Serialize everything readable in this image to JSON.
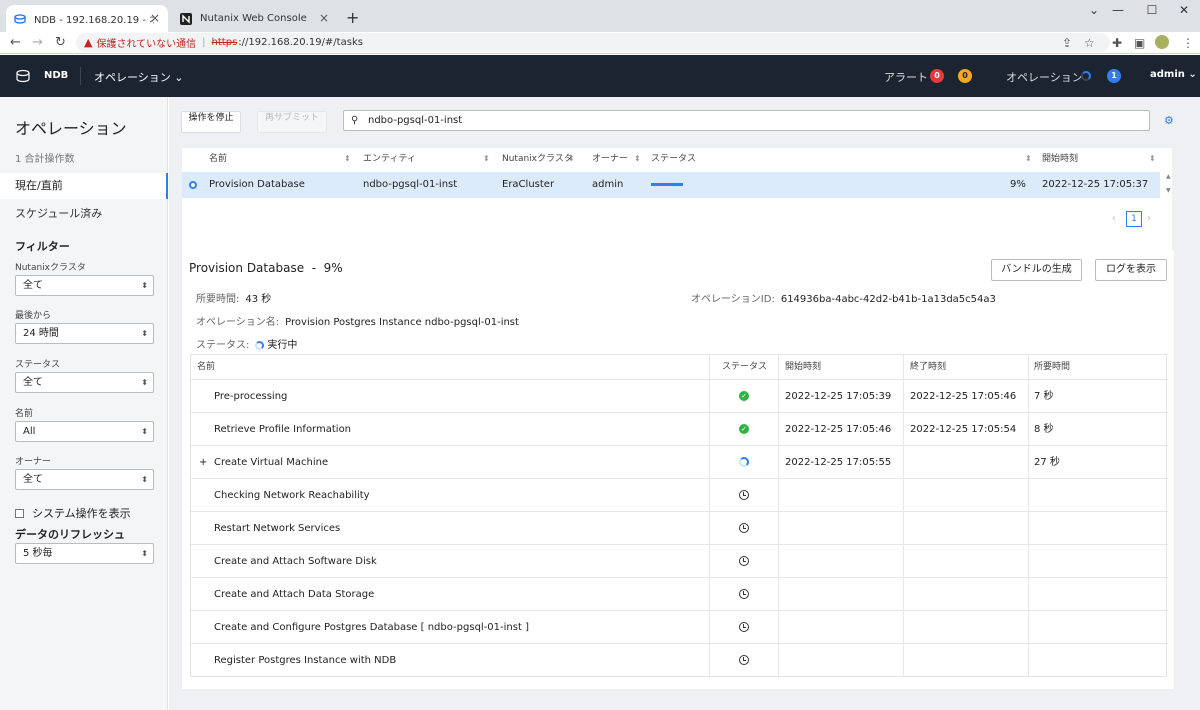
{
  "browser": {
    "tabs": [
      {
        "title": "NDB - 192.168.20.19 - オペレーショ",
        "active": true
      },
      {
        "title": "Nutanix Web Console",
        "active": false
      }
    ],
    "address": {
      "security_warning": "保護されていない通信",
      "scheme": "https",
      "rest": "://192.168.20.19/#/tasks"
    }
  },
  "header": {
    "brand": "NDB",
    "menu": "オペレーション ⌄",
    "alerts_label": "アラート",
    "alert_red_count": "0",
    "alert_orange_count": "0",
    "operations_label": "オペレーション",
    "operations_count": "1",
    "user": "admin ⌄"
  },
  "sidebar": {
    "title": "オペレーション",
    "total": "1 合計操作数",
    "nav": [
      "現在/直前",
      "スケジュール済み"
    ],
    "filter_title": "フィルター",
    "filters": [
      {
        "label": "Nutanixクラスタ",
        "value": "全て"
      },
      {
        "label": "最後から",
        "value": "24 時間"
      },
      {
        "label": "ステータス",
        "value": "全て"
      },
      {
        "label": "名前",
        "value": "All"
      },
      {
        "label": "オーナー",
        "value": "全て"
      }
    ],
    "show_system_ops": "システム操作を表示",
    "refresh_label": "データのリフレッシュ",
    "refresh_value": "5 秒毎"
  },
  "toolbar": {
    "stop_button": "操作を停止",
    "resubmit_button": "再サブミット",
    "search_value": "ndbo-pgsql-01-inst"
  },
  "ops_table": {
    "headers": [
      "名前",
      "エンティティ",
      "Nutanixクラスタ",
      "オーナー",
      "ステータス",
      "開始時刻"
    ],
    "row": {
      "name": "Provision Database",
      "entity": "ndbo-pgsql-01-inst",
      "cluster": "EraCluster",
      "owner": "admin",
      "progress": 9,
      "percent": "9%",
      "start": "2022-12-25 17:05:37"
    },
    "page": "1"
  },
  "detail": {
    "title": "Provision Database  -  9%",
    "bundle_button": "バンドルの生成",
    "log_button": "ログを表示",
    "elapsed_label": "所要時間:",
    "elapsed_value": "43 秒",
    "opid_label": "オペレーションID:",
    "opid_value": "614936ba-4abc-42d2-b41b-1a13da5c54a3",
    "opname_label": "オペレーション名:",
    "opname_value": "Provision Postgres Instance ndbo-pgsql-01-inst",
    "status_label": "ステータス:",
    "status_value": "実行中",
    "step_headers": [
      "名前",
      "ステータス",
      "開始時刻",
      "終了時刻",
      "所要時間"
    ],
    "steps": [
      {
        "name": "Pre-processing",
        "status": "done",
        "start": "2022-12-25 17:05:39",
        "end": "2022-12-25 17:05:46",
        "duration": "7 秒"
      },
      {
        "name": "Retrieve Profile Information",
        "status": "done",
        "start": "2022-12-25 17:05:46",
        "end": "2022-12-25 17:05:54",
        "duration": "8 秒"
      },
      {
        "name": "Create Virtual Machine",
        "status": "running",
        "start": "2022-12-25 17:05:55",
        "end": "",
        "duration": "27 秒",
        "expand": "+"
      },
      {
        "name": "Checking Network Reachability",
        "status": "pending",
        "start": "",
        "end": "",
        "duration": ""
      },
      {
        "name": "Restart Network Services",
        "status": "pending",
        "start": "",
        "end": "",
        "duration": ""
      },
      {
        "name": "Create and Attach Software Disk",
        "status": "pending",
        "start": "",
        "end": "",
        "duration": ""
      },
      {
        "name": "Create and Attach Data Storage",
        "status": "pending",
        "start": "",
        "end": "",
        "duration": ""
      },
      {
        "name": "Create and Configure Postgres Database [ ndbo-pgsql-01-inst ]",
        "status": "pending",
        "start": "",
        "end": "",
        "duration": ""
      },
      {
        "name": "Register Postgres Instance with NDB",
        "status": "pending",
        "start": "",
        "end": "",
        "duration": ""
      }
    ]
  },
  "colors": {
    "accent": "#2f80ed",
    "header_bg": "#1b2430",
    "success": "#2fb344",
    "alert_red": "#e5393b",
    "alert_orange": "#f5a623"
  }
}
